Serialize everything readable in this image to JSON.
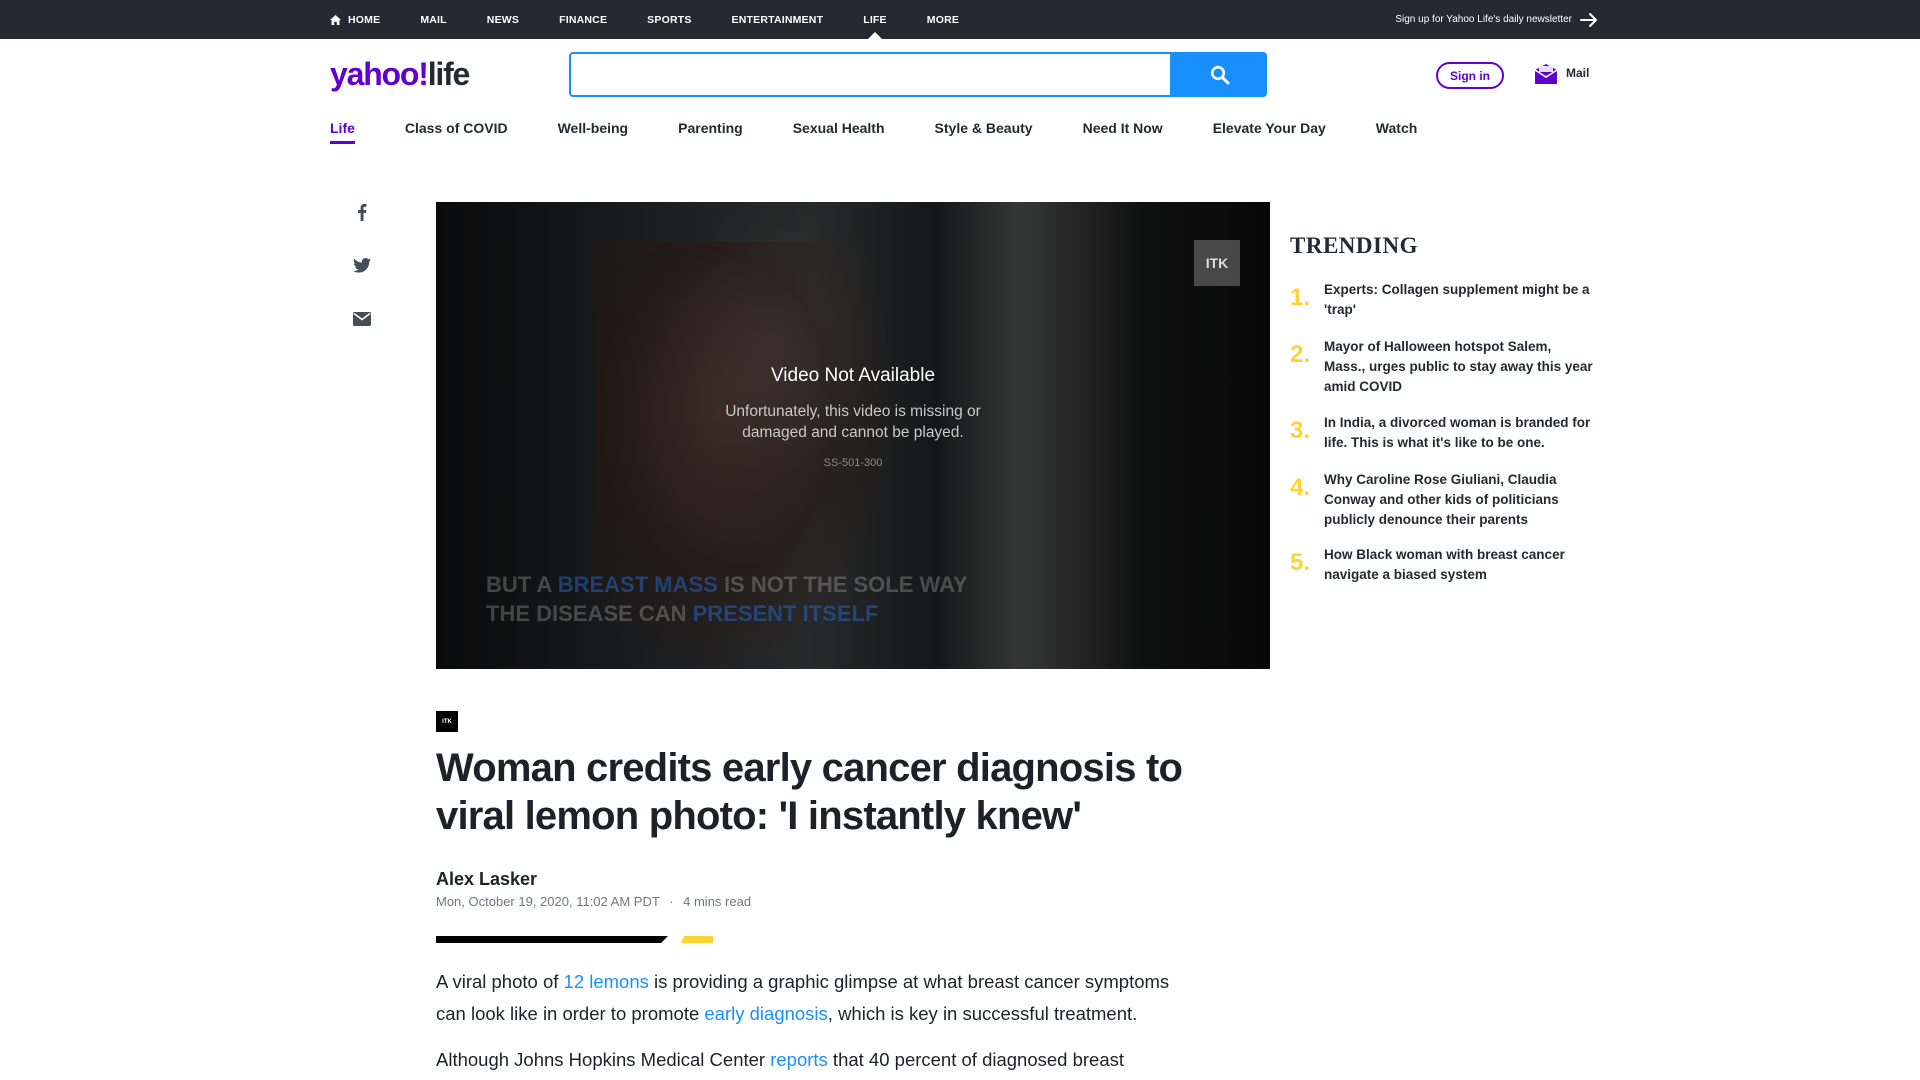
{
  "topnav": {
    "items": [
      "HOME",
      "MAIL",
      "NEWS",
      "FINANCE",
      "SPORTS",
      "ENTERTAINMENT",
      "LIFE",
      "MORE"
    ],
    "active": "LIFE",
    "newsletter": "Sign up for Yahoo Life's daily newsletter"
  },
  "header": {
    "logo_yahoo": "yahoo!",
    "logo_life": "life",
    "search_placeholder": "",
    "signin": "Sign in",
    "mail": "Mail"
  },
  "subnav": {
    "items": [
      "Life",
      "Class of COVID",
      "Well-being",
      "Parenting",
      "Sexual Health",
      "Style & Beauty",
      "Need It Now",
      "Elevate Your Day",
      "Watch"
    ],
    "active": "Life"
  },
  "video": {
    "title": "Video Not Available",
    "message": "Unfortunately, this video is missing or damaged and cannot be played.",
    "code": "SS-501-300",
    "badge": "ITK",
    "caption_line1_a": "BUT A ",
    "caption_line1_hl": "BREAST MASS",
    "caption_line1_b": " IS NOT THE SOLE WAY",
    "caption_line2_a": "THE DISEASE CAN ",
    "caption_line2_hl": "PRESENT ITSELF"
  },
  "article": {
    "provider_badge": "ITK",
    "headline": "Woman credits early cancer diagnosis to viral lemon photo: 'I instantly knew'",
    "author": "Alex Lasker",
    "date": "Mon, October 19, 2020, 11:02 AM PDT",
    "separator": "·",
    "read_time": "4 mins read",
    "p1_a": "A viral photo of ",
    "p1_link1": "12 lemons",
    "p1_b": " is providing a graphic glimpse at what breast cancer symptoms can look like in order to promote ",
    "p1_link2": "early diagnosis",
    "p1_c": ", which is key in successful treatment.",
    "p2_a": "Although Johns Hopkins Medical Center ",
    "p2_link": "reports",
    "p2_b": " that 40 percent of diagnosed breast"
  },
  "trending": {
    "title": "TRENDING",
    "items": [
      {
        "num": "1.",
        "text": "Experts: Collagen supplement might be a 'trap'"
      },
      {
        "num": "2.",
        "text": "Mayor of Halloween hotspot Salem, Mass., urges public to stay away this year amid COVID"
      },
      {
        "num": "3.",
        "text": "In India, a divorced woman is branded for life. This is what it's like to be one."
      },
      {
        "num": "4.",
        "text": "Why Caroline Rose Giuliani, Claudia Conway and other kids of politicians publicly denounce their parents"
      },
      {
        "num": "5.",
        "text": "How Black woman with breast cancer navigate a biased system"
      }
    ]
  },
  "colors": {
    "brand_purple": "#6001d2",
    "link_blue": "#188fff",
    "trending_yellow": "#ffd333",
    "topbar": "#232a31"
  }
}
